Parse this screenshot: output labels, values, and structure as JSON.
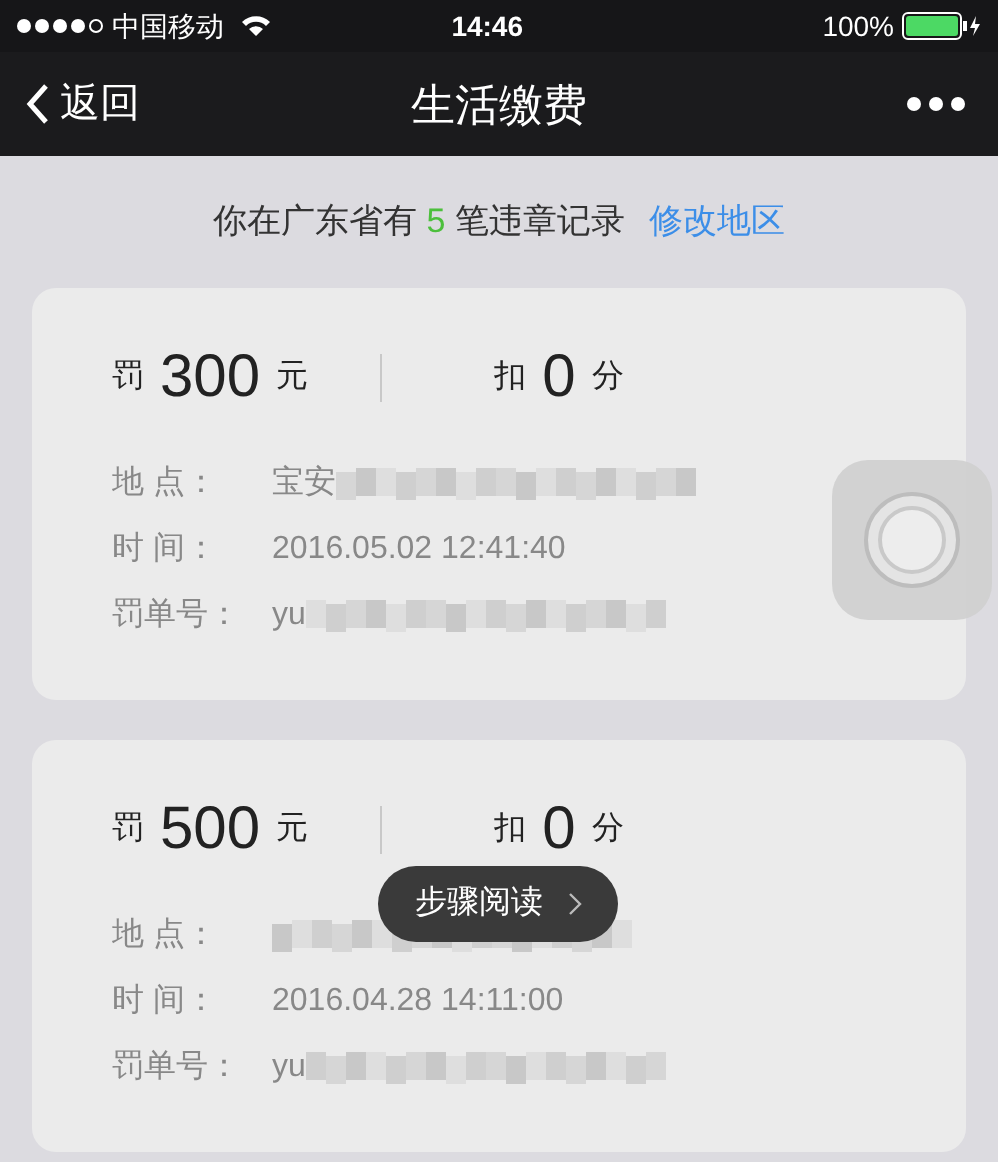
{
  "status_bar": {
    "carrier": "中国移动",
    "time": "14:46",
    "battery": "100%"
  },
  "nav": {
    "back": "返回",
    "title": "生活缴费"
  },
  "summary": {
    "before": "你在广东省有",
    "count": "5",
    "after": "笔违章记录",
    "link": "修改地区"
  },
  "records": [
    {
      "fine_label": "罚",
      "fine": "300",
      "fine_unit": "元",
      "points_label": "扣",
      "points": "0",
      "points_unit": "分",
      "fields": [
        {
          "label": "地 点：",
          "value": "宝安",
          "redacted": true
        },
        {
          "label": "时 间：",
          "value": "2016.05.02 12:41:40",
          "redacted": false
        },
        {
          "label": "罚单号：",
          "value": "yu",
          "redacted": true
        }
      ]
    },
    {
      "fine_label": "罚",
      "fine": "500",
      "fine_unit": "元",
      "points_label": "扣",
      "points": "0",
      "points_unit": "分",
      "fields": [
        {
          "label": "地 点：",
          "redacted": true
        },
        {
          "label": "时 间：",
          "value": "2016.04.28 14:11:00",
          "redacted": false
        },
        {
          "label": "罚单号：",
          "value": "yu",
          "redacted": true
        }
      ]
    }
  ],
  "toast": {
    "label": "步骤阅读"
  }
}
